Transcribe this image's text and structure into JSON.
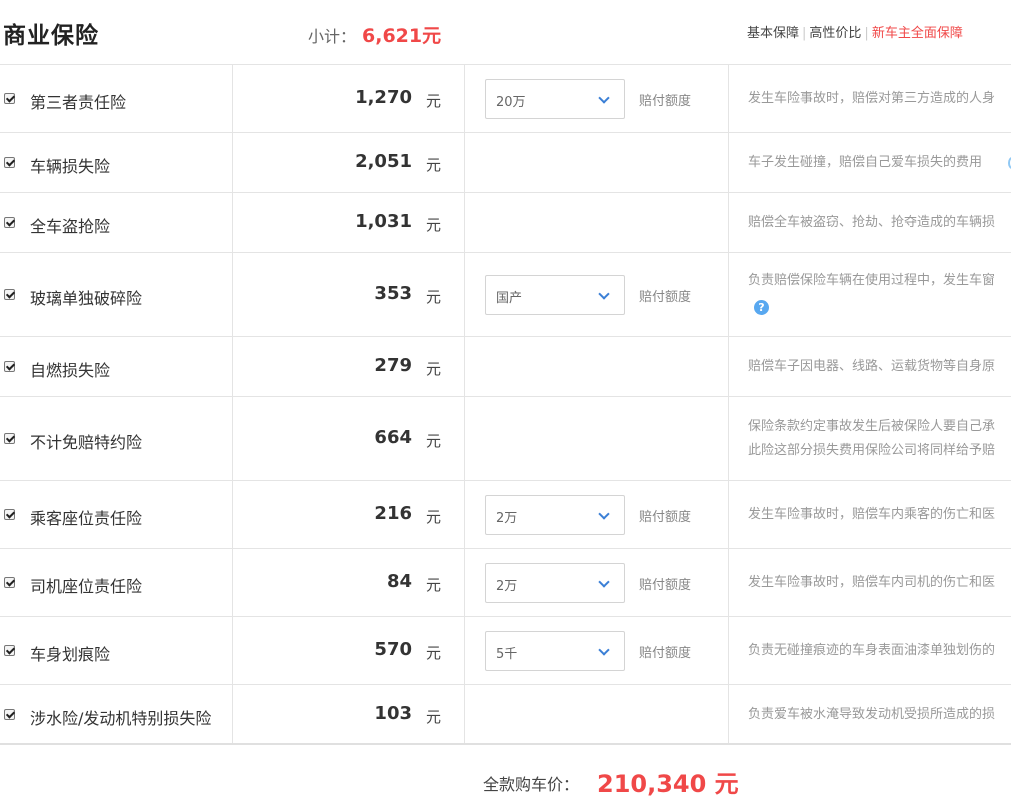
{
  "header": {
    "title": "商业保险",
    "subtotal_label": "小计：",
    "subtotal_value": "6,621元",
    "tabs": [
      {
        "label": "基本保障"
      },
      {
        "label": "高性价比"
      },
      {
        "label": "新车主全面保障"
      }
    ]
  },
  "rows": [
    {
      "name": "第三者责任险",
      "price": "1,270",
      "unit": "元",
      "select": "20万",
      "limit_label": "赔付额度",
      "desc": [
        "发生车险事故时，赔偿对第三方造成的人身"
      ]
    },
    {
      "name": "车辆损失险",
      "price": "2,051",
      "unit": "元",
      "desc": [
        "车子发生碰撞，赔偿自己爱车损失的费用"
      ]
    },
    {
      "name": "全车盗抢险",
      "price": "1,031",
      "unit": "元",
      "desc": [
        "赔偿全车被盗窃、抢劫、抢夺造成的车辆损"
      ]
    },
    {
      "name": "玻璃单独破碎险",
      "price": "353",
      "unit": "元",
      "select": "国产",
      "limit_label": "赔付额度",
      "desc": [
        "负责赔偿保险车辆在使用过程中，发生车窗"
      ],
      "help": "?"
    },
    {
      "name": "自燃损失险",
      "price": "279",
      "unit": "元",
      "desc": [
        "赔偿车子因电器、线路、运载货物等自身原"
      ]
    },
    {
      "name": "不计免赔特约险",
      "price": "664",
      "unit": "元",
      "desc": [
        "保险条款约定事故发生后被保险人要自己承",
        "此险这部分损失费用保险公司将同样给予赔"
      ]
    },
    {
      "name": "乘客座位责任险",
      "price": "216",
      "unit": "元",
      "select": "2万",
      "limit_label": "赔付额度",
      "desc": [
        "发生车险事故时，赔偿车内乘客的伤亡和医"
      ]
    },
    {
      "name": "司机座位责任险",
      "price": "84",
      "unit": "元",
      "select": "2万",
      "limit_label": "赔付额度",
      "desc": [
        "发生车险事故时，赔偿车内司机的伤亡和医"
      ]
    },
    {
      "name": "车身划痕险",
      "price": "570",
      "unit": "元",
      "select": "5千",
      "limit_label": "赔付额度",
      "desc": [
        "负责无碰撞痕迹的车身表面油漆单独划伤的"
      ]
    },
    {
      "name": "涉水险/发动机特别损失险",
      "price": "103",
      "unit": "元",
      "desc": [
        "负责爱车被水淹导致发动机受损所造成的损"
      ]
    }
  ],
  "footer": {
    "total_label": "全款购车价：",
    "total_value": "210,340 元"
  },
  "colors": {
    "accent_red": "#f04848",
    "select_chevron": "#3b7fd6",
    "help_icon": "#58a8f0"
  }
}
